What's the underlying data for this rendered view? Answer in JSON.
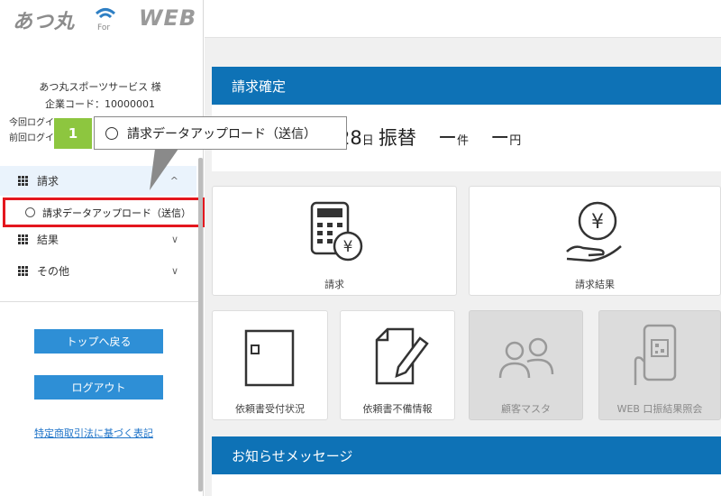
{
  "logo": {
    "brand": "あつ丸",
    "for": "For",
    "web": "WEB"
  },
  "sidebar": {
    "company_name": "あつ丸スポーツサービス 様",
    "company_code": "企業コード：10000001",
    "login_current": "今回ログイ",
    "login_previous": "前回ログイ",
    "menu": [
      {
        "label": "請求",
        "chevron": "^"
      },
      {
        "label": "結果",
        "chevron": "∨"
      },
      {
        "label": "その他",
        "chevron": "∨"
      }
    ],
    "sub_item": "請求データアップロード（送信）",
    "buttons": {
      "top": "トップへ戻る",
      "logout": "ログアウト"
    },
    "legal_link": "特定商取引法に基づく表記"
  },
  "main": {
    "billing": {
      "header": "請求確定",
      "day": "28",
      "day_unit": "日",
      "method": "振替",
      "count": "ー",
      "count_unit": "件",
      "amount": "ー",
      "amount_unit": "円"
    },
    "tiles": [
      {
        "label": "請求",
        "icon": "calculator-yen-icon",
        "enabled": true
      },
      {
        "label": "請求結果",
        "icon": "hand-yen-coin-icon",
        "enabled": true
      },
      {
        "label": "依頼書受付状況",
        "icon": "envelope-icon",
        "enabled": true
      },
      {
        "label": "依頼書不備情報",
        "icon": "document-pencil-icon",
        "enabled": true
      },
      {
        "label": "顧客マスタ",
        "icon": "users-icon",
        "enabled": false
      },
      {
        "label": "WEB 口振結果照会",
        "icon": "phone-qr-icon",
        "enabled": false
      }
    ],
    "notice_header": "お知らせメッセージ"
  },
  "callout": {
    "step": "1",
    "text": "請求データアップロード（送信）"
  },
  "colors": {
    "primary": "#0e72b6",
    "button": "#2e8fd6",
    "highlight": "#e4171e",
    "badge": "#8dc63f"
  }
}
